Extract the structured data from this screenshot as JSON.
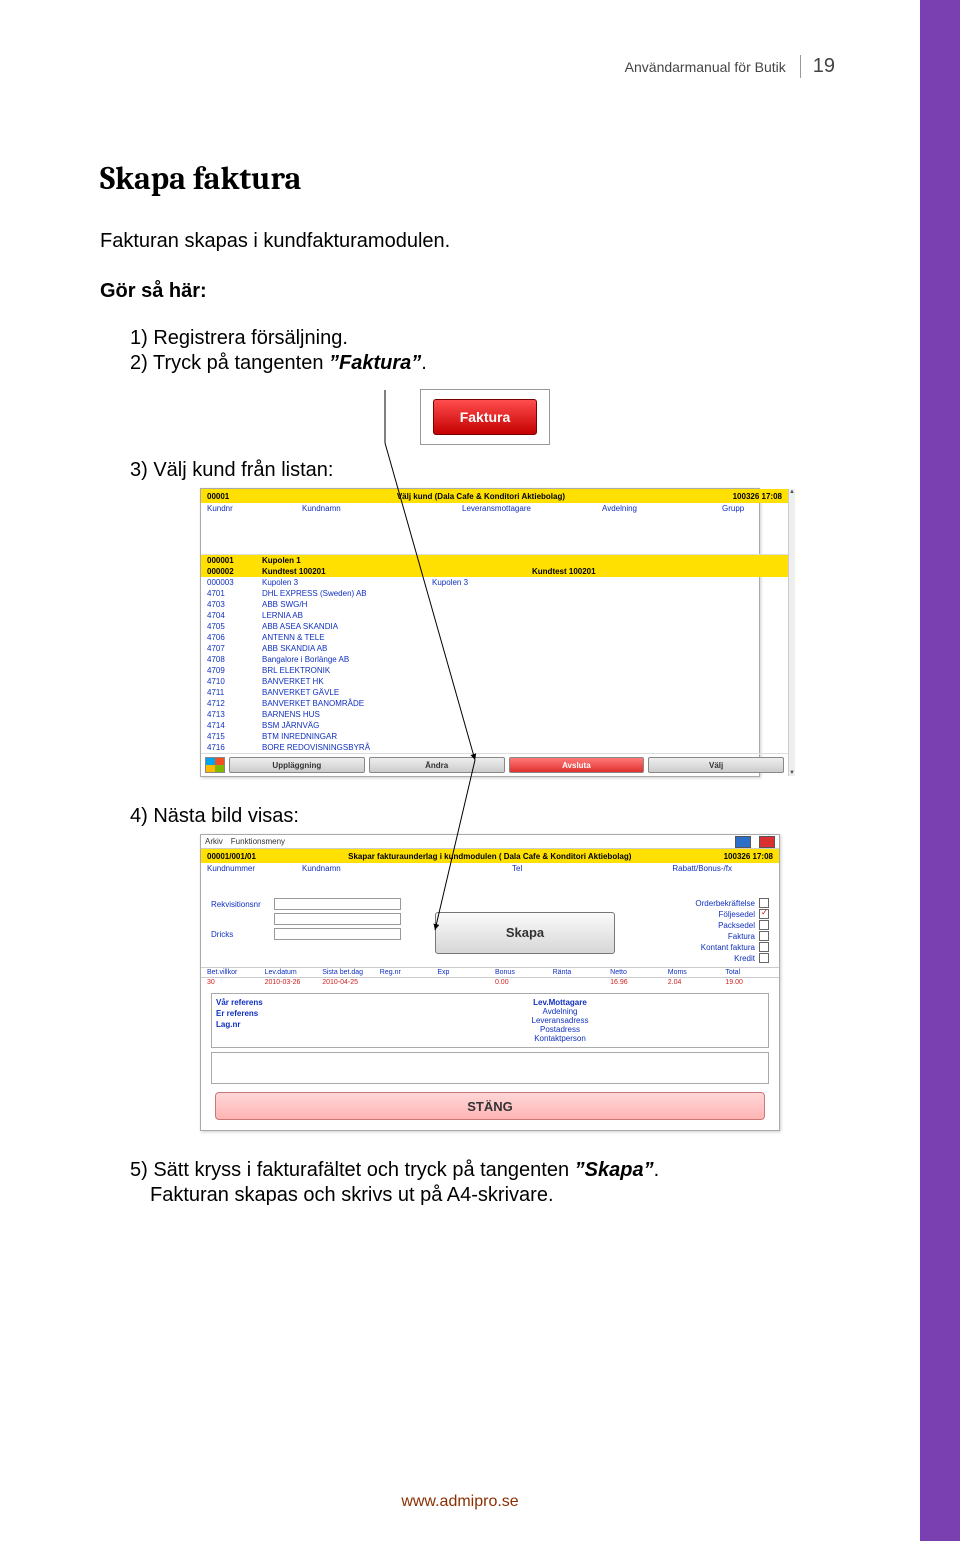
{
  "header": {
    "doc_title": "Användarmanual för Butik",
    "page_num": "19"
  },
  "h1": "Skapa faktura",
  "p_intro": "Fakturan skapas i kundfakturamodulen.",
  "p_how": "Gör så här:",
  "steps": {
    "s1": "1) Registrera försäljning.",
    "s2_a": "2) Tryck på tangenten ",
    "s2_b": "”Faktura”",
    "s2_c": ".",
    "s3": "3) Välj kund från listan:",
    "s4": "4) Nästa bild visas:",
    "s5_a": "5) Sätt kryss i fakturafältet och tryck på tangenten ",
    "s5_b": "”Skapa”",
    "s5_c": ".",
    "s5_next": "Fakturan skapas och skrivs ut på A4-skrivare."
  },
  "faktura_btn": "Faktura",
  "shot1": {
    "top_left": "00001",
    "top_mid": "Välj kund (Dala Cafe & Konditori Aktiebolag)",
    "top_right": "100326 17:08",
    "cols": [
      "Kundnr",
      "Kundnamn",
      "Leveransmottagare",
      "Avdelning",
      "Grupp"
    ],
    "rows": [
      {
        "nr": "000001",
        "namn": "Kupolen 1",
        "lev": "",
        "extra": "",
        "hl": true
      },
      {
        "nr": "000002",
        "namn": "Kundtest 100201",
        "lev": "",
        "extra": "Kundtest 100201",
        "hl": true
      },
      {
        "nr": "000003",
        "namn": "Kupolen 3",
        "lev": "Kupolen 3",
        "extra": ""
      },
      {
        "nr": "4701",
        "namn": "DHL EXPRESS (Sweden) AB",
        "lev": "",
        "extra": ""
      },
      {
        "nr": "4703",
        "namn": "ABB SWG/H",
        "lev": "",
        "extra": ""
      },
      {
        "nr": "4704",
        "namn": "LERNIA AB",
        "lev": "",
        "extra": ""
      },
      {
        "nr": "4705",
        "namn": "ABB ASEA SKANDIA",
        "lev": "",
        "extra": ""
      },
      {
        "nr": "4706",
        "namn": "ANTENN & TELE",
        "lev": "",
        "extra": ""
      },
      {
        "nr": "4707",
        "namn": "ABB SKANDIA AB",
        "lev": "",
        "extra": ""
      },
      {
        "nr": "4708",
        "namn": "Bangalore i Borlänge AB",
        "lev": "",
        "extra": ""
      },
      {
        "nr": "4709",
        "namn": "BRL ELEKTRONIK",
        "lev": "",
        "extra": ""
      },
      {
        "nr": "4710",
        "namn": "BANVERKET HK",
        "lev": "",
        "extra": ""
      },
      {
        "nr": "4711",
        "namn": "BANVERKET GÄVLE",
        "lev": "",
        "extra": ""
      },
      {
        "nr": "4712",
        "namn": "BANVERKET BANOMRÅDE",
        "lev": "",
        "extra": ""
      },
      {
        "nr": "4713",
        "namn": "BARNENS HUS",
        "lev": "",
        "extra": ""
      },
      {
        "nr": "4714",
        "namn": "BSM JÄRNVÄG",
        "lev": "",
        "extra": ""
      },
      {
        "nr": "4715",
        "namn": "BTM INREDNINGAR",
        "lev": "",
        "extra": ""
      },
      {
        "nr": "4716",
        "namn": "BORE REDOVISNINGSBYRÅ",
        "lev": "",
        "extra": ""
      }
    ],
    "foot": [
      "Uppläggning",
      "Ändra",
      "Avsluta",
      "Välj"
    ]
  },
  "shot2": {
    "menu": [
      "Arkiv",
      "Funktionsmeny"
    ],
    "top_left": "00001/001/01",
    "top_mid": "Skapar fakturaunderlag i kundmodulen ( Dala Cafe & Konditori Aktiebolag)",
    "top_right": "100326 17:08",
    "blue_cols": [
      "Kundnummer",
      "Kundnamn",
      "Tel",
      "Rabatt/Bonus-/fx"
    ],
    "left_labels": [
      "Rekvisitionsnr",
      "",
      "Dricks"
    ],
    "right_labels": [
      "Orderbekräftelse",
      "Följesedel",
      "Packsedel",
      "Faktura",
      "Kontant faktura",
      "Kredit"
    ],
    "right_checked_index": 1,
    "skapa": "Skapa",
    "grid_cols": [
      "Bet.villkor",
      "Lev.datum",
      "Sista bet.dag",
      "Reg.nr",
      "Exp",
      "Bonus",
      "Ränta",
      "Netto",
      "Moms",
      "Total"
    ],
    "grid_vals": [
      "30",
      "2010-03-26",
      "2010-04-25",
      "",
      "",
      "0.00",
      "",
      "16.96",
      "2.04",
      "19.00"
    ],
    "ref_left": [
      "Vår referens",
      "Er referens",
      "Lag.nr"
    ],
    "ref_mid_head": "Lev.Mottagare",
    "ref_mid": [
      "Avdelning",
      "Leveransadress",
      "Postadress",
      "Kontaktperson"
    ],
    "stang": "STÄNG"
  },
  "footer_url": "www.admipro.se"
}
